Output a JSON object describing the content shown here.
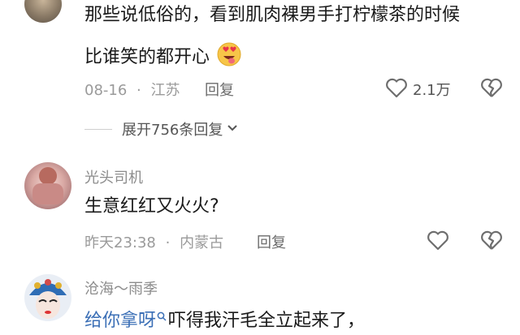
{
  "comments": [
    {
      "text_line1": "那些说低俗的，看到肌肉裸男手打柠檬茶的时候",
      "text_line2": "比谁笑的都开心",
      "emoji": "heart-eyes-tongue-emoji",
      "date": "08-16",
      "separator": "·",
      "location": "江苏",
      "reply_label": "回复",
      "like_count": "2.1万",
      "expand_label": "展开756条回复"
    },
    {
      "username": "光头司机",
      "text": "生意红红又火火?",
      "date": "昨天23:38",
      "separator": "·",
      "location": "内蒙古",
      "reply_label": "回复"
    },
    {
      "username": "沧海～雨季",
      "mention": "给你拿呀",
      "text": "吓得我汗毛全立起来了，"
    }
  ],
  "colors": {
    "text": "#1a1a1a",
    "meta": "#9a9a9a",
    "mention": "#3b6fb6",
    "icon": "#6e6e6e"
  }
}
